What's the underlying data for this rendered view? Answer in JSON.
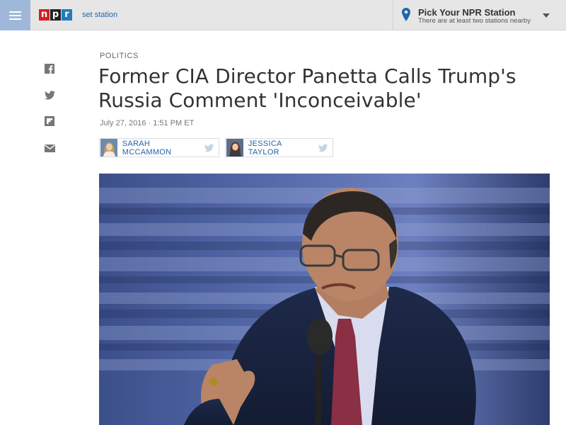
{
  "header": {
    "logo_letters": [
      "n",
      "p",
      "r"
    ],
    "set_station_label": "set station",
    "station_picker": {
      "title": "Pick Your NPR Station",
      "subtitle": "There are at least two stations nearby"
    }
  },
  "share_icons": [
    "facebook-icon",
    "twitter-icon",
    "flipboard-icon",
    "email-icon"
  ],
  "article": {
    "slug": "Politics",
    "headline": "Former CIA Director Panetta Calls Trump's Russia Comment 'Inconceivable'",
    "date": "July 27, 2016 · 1:51 PM ET",
    "bylines": [
      {
        "name": "Sarah McCammon"
      },
      {
        "name": "Jessica Taylor"
      }
    ]
  },
  "colors": {
    "npr_red": "#d62021",
    "npr_black": "#222222",
    "npr_blue": "#237bbd",
    "link_blue": "#2366a8",
    "menu_blue": "#9fb7d9",
    "header_gray": "#e6e6e6"
  }
}
